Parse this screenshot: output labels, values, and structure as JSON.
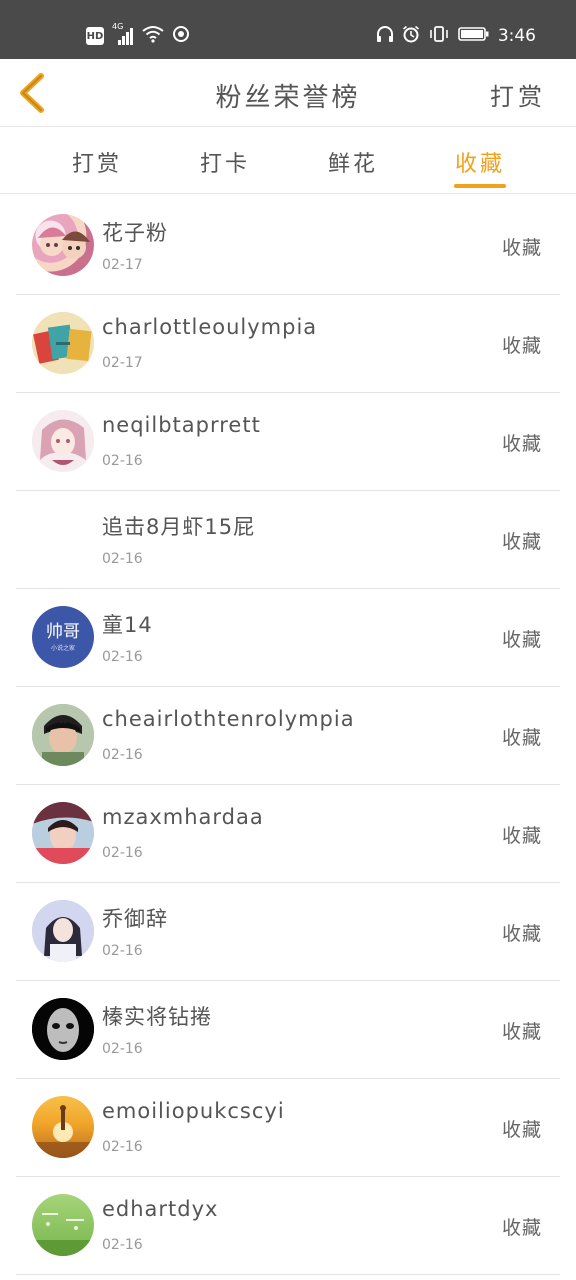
{
  "status_bar": {
    "hd_label": "HD",
    "network_label": "4G",
    "time": "3:46"
  },
  "header": {
    "title": "粉丝荣誉榜",
    "action_label": "打赏",
    "back_icon": "chevron-left-icon",
    "back_color": "#f0a21b"
  },
  "tabs": [
    {
      "label": "打赏"
    },
    {
      "label": "打卡"
    },
    {
      "label": "鲜花"
    },
    {
      "label": "收藏"
    }
  ],
  "active_tab": "收藏",
  "accent_color": "#f0a21b",
  "list": [
    {
      "name": "花子粉",
      "date": "02-17",
      "action": "收藏",
      "avatar_style": "anime-pink"
    },
    {
      "name": "charlottleoulympia",
      "date": "02-17",
      "action": "收藏",
      "avatar_style": "notebooks"
    },
    {
      "name": "neqilbtaprrett",
      "date": "02-16",
      "action": "收藏",
      "avatar_style": "anime-girl"
    },
    {
      "name": "追击8月虾15屁",
      "date": "02-16",
      "action": "收藏",
      "avatar_style": "none"
    },
    {
      "name": "童14",
      "date": "02-16",
      "action": "收藏",
      "avatar_style": "text-badge",
      "avatar_text": "帅哥",
      "avatar_subtext": "小说之家"
    },
    {
      "name": "cheairlothtenrolympia",
      "date": "02-16",
      "action": "收藏",
      "avatar_style": "photo-boy"
    },
    {
      "name": "mzaxmhardaa",
      "date": "02-16",
      "action": "收藏",
      "avatar_style": "photo-pink"
    },
    {
      "name": "乔御辞",
      "date": "02-16",
      "action": "收藏",
      "avatar_style": "photo-girl"
    },
    {
      "name": "榛实将钻捲",
      "date": "02-16",
      "action": "收藏",
      "avatar_style": "mask"
    },
    {
      "name": "emoiliopukcscyi",
      "date": "02-16",
      "action": "收藏",
      "avatar_style": "sunset"
    },
    {
      "name": "edhartdyx",
      "date": "02-16",
      "action": "收藏",
      "avatar_style": "green"
    }
  ]
}
